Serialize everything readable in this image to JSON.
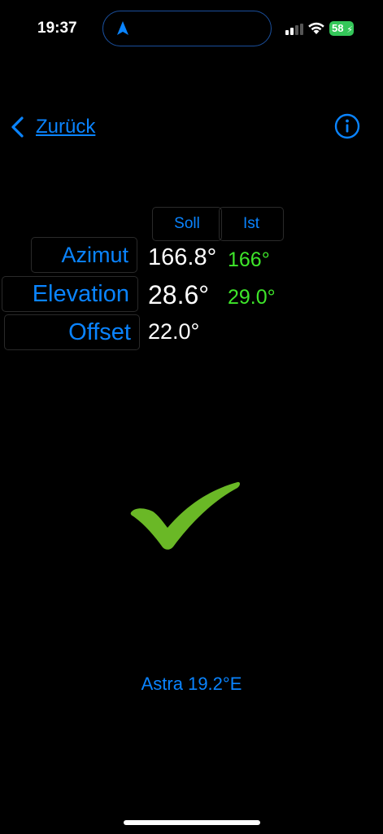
{
  "status_bar": {
    "time": "19:37",
    "battery": "58",
    "icons": [
      "location-arrow-icon",
      "cellular-signal-icon",
      "wifi-icon",
      "battery-charging-icon"
    ]
  },
  "nav": {
    "back_label": "Zurück",
    "back_icon": "chevron-left-icon",
    "info_icon": "info-circle-icon"
  },
  "table": {
    "headers": {
      "soll": "Soll",
      "ist": "Ist"
    },
    "rows": [
      {
        "label": "Azimut",
        "soll": "166.8°",
        "ist": "166°"
      },
      {
        "label": "Elevation",
        "soll": "28.6°",
        "ist": "29.0°"
      },
      {
        "label": "Offset",
        "soll": "22.0°",
        "ist": ""
      }
    ]
  },
  "status_icon": "checkmark-icon",
  "satellite": "Astra 19.2°E",
  "colors": {
    "accent": "#0a84ff",
    "ist_value": "#3ee62a",
    "check": "#6ab826",
    "battery": "#34c759",
    "background": "#000000"
  }
}
